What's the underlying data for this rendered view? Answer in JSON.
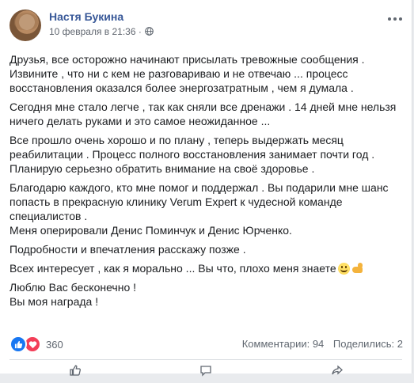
{
  "post": {
    "author": "Настя Букина",
    "timestamp": "10 февраля в 21:36",
    "separator": "·",
    "privacy_icon": "globe-icon",
    "more_icon": "more-horizontal-icon",
    "paragraphs": [
      "Друзья, все осторожно начинают присылать тревожные сообщения .\nИзвините , что ни с кем не разговариваю и не отвечаю ... процесс\nвосстановления оказался более энергозатратным , чем я думала .",
      "Сегодня мне стало легче , так как сняли все дренажи . 14 дней мне нельзя\nничего делать руками и это самое неожиданное ...",
      "Все прошло очень хорошо и по плану , теперь выдержать месяц\nреабилитации . Процесс полного восстановления занимает почти год .\nПланирую серьезно обратить внимание на своё здоровье .",
      "Благодарю каждого, кто мне помог и поддержал . Вы подарили мне шанс\nпопасть в прекрасную клинику Verum Expert к чудесной команде\nспециалистов .\nМеня оперировали Денис Поминчук и Денис Юрченко.",
      "Подробности и впечатления расскажу позже .",
      "Всех интересует , как я морально ... Вы что, плохо меня знаете",
      "Люблю Вас бесконечно !\nВы моя награда !"
    ],
    "emojis": [
      "smile-emoji",
      "muscle-emoji"
    ]
  },
  "stats": {
    "reaction_icons": [
      "like-icon",
      "love-icon"
    ],
    "reaction_count": "360",
    "comments": "Комментарии: 94",
    "shares": "Поделились: 2"
  },
  "actions": [
    {
      "icon": "like-action-icon"
    },
    {
      "icon": "comment-action-icon"
    },
    {
      "icon": "share-action-icon"
    }
  ],
  "colors": {
    "author_link": "#385898",
    "like_blue": "#1877f2",
    "love_red": "#f33e58",
    "muted_text": "#606770"
  }
}
